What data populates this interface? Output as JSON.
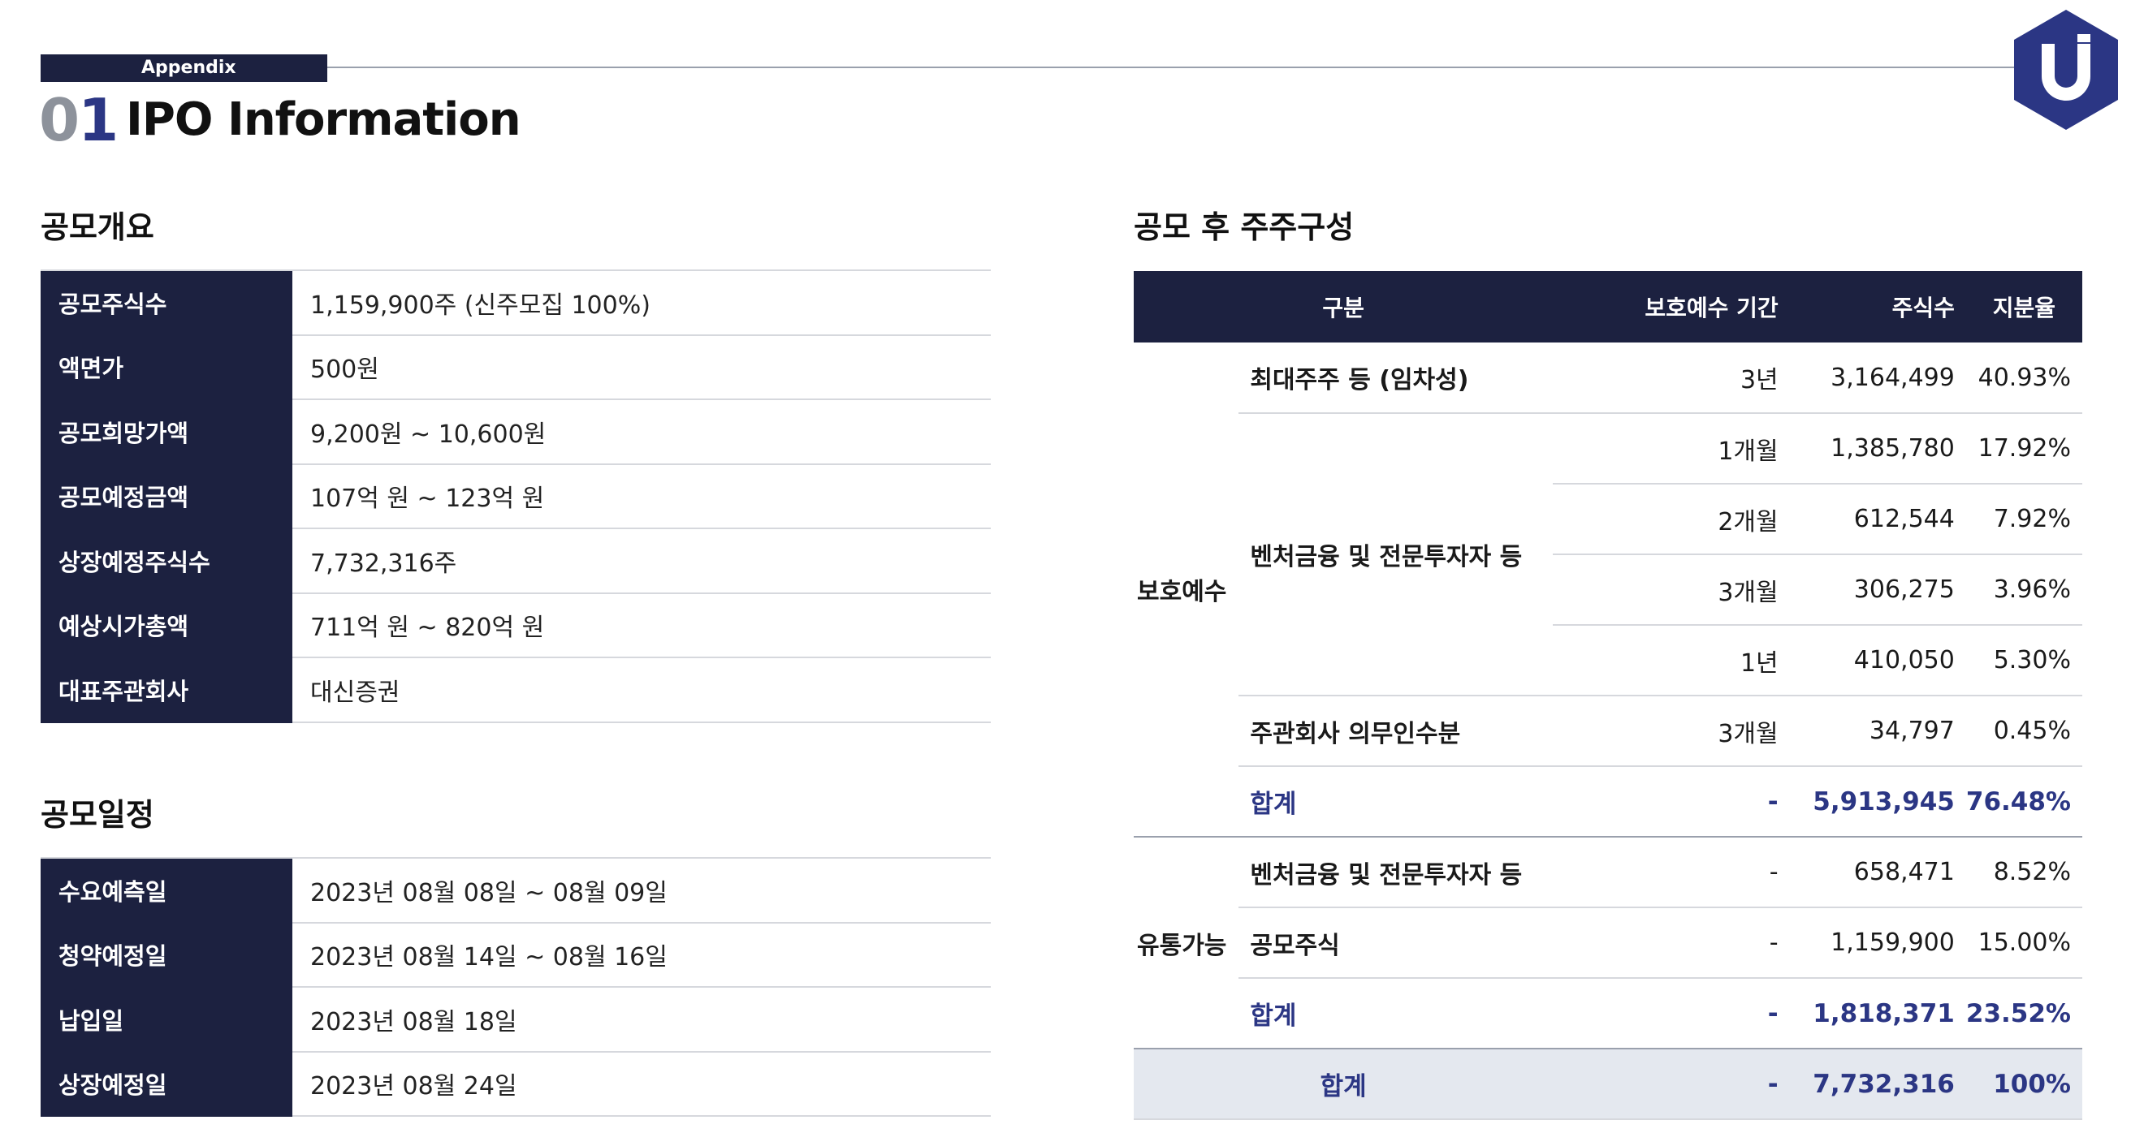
{
  "header": {
    "appendix_label": "Appendix",
    "page_number_prefix": "0",
    "page_number_suffix": "1",
    "title": "IPO Information"
  },
  "brand": {
    "logo_icon": "hexagon-u-logo-icon",
    "navy": "#1c2140",
    "accent_blue": "#2b3684",
    "gray_digit": "#8d929b"
  },
  "offering_overview": {
    "title": "공모개요",
    "rows": [
      {
        "label": "공모주식수",
        "value": "1,159,900주 (신주모집 100%)"
      },
      {
        "label": "액면가",
        "value": "500원"
      },
      {
        "label": "공모희망가액",
        "value": "9,200원 ~ 10,600원"
      },
      {
        "label": "공모예정금액",
        "value": "107억 원 ~ 123억 원"
      },
      {
        "label": "상장예정주식수",
        "value": "7,732,316주"
      },
      {
        "label": "예상시가총액",
        "value": "711억 원 ~ 820억 원"
      },
      {
        "label": "대표주관회사",
        "value": "대신증권"
      }
    ]
  },
  "offering_schedule": {
    "title": "공모일정",
    "rows": [
      {
        "label": "수요예측일",
        "value": "2023년 08월 08일 ~ 08월 09일"
      },
      {
        "label": "청약예정일",
        "value": "2023년 08월 14일 ~ 08월 16일"
      },
      {
        "label": "납입일",
        "value": "2023년 08월 18일"
      },
      {
        "label": "상장예정일",
        "value": "2023년 08월 24일"
      }
    ]
  },
  "shareholders": {
    "title": "공모 후 주주구성",
    "headers": {
      "category": "구분",
      "lockup": "보호예수 기간",
      "shares": "주식수",
      "ratio": "지분율"
    },
    "locked": {
      "group": "보호예수",
      "r1": {
        "category": "최대주주 등 (임차성)",
        "lockup": "3년",
        "shares": "3,164,499",
        "ratio": "40.93%"
      },
      "venture": {
        "category": "벤처금융 및 전문투자자 등",
        "rows": [
          {
            "lockup": "1개월",
            "shares": "1,385,780",
            "ratio": "17.92%"
          },
          {
            "lockup": "2개월",
            "shares": "612,544",
            "ratio": "7.92%"
          },
          {
            "lockup": "3개월",
            "shares": "306,275",
            "ratio": "3.96%"
          },
          {
            "lockup": "1년",
            "shares": "410,050",
            "ratio": "5.30%"
          }
        ]
      },
      "r6": {
        "category": "주관회사 의무인수분",
        "lockup": "3개월",
        "shares": "34,797",
        "ratio": "0.45%"
      },
      "subtotal": {
        "category": "합계",
        "lockup": "-",
        "shares": "5,913,945",
        "ratio": "76.48%"
      }
    },
    "tradable": {
      "group": "유통가능",
      "r1": {
        "category": "벤처금융 및 전문투자자 등",
        "lockup": "-",
        "shares": "658,471",
        "ratio": "8.52%"
      },
      "r2": {
        "category": "공모주식",
        "lockup": "-",
        "shares": "1,159,900",
        "ratio": "15.00%"
      },
      "subtotal": {
        "category": "합계",
        "lockup": "-",
        "shares": "1,818,371",
        "ratio": "23.52%"
      }
    },
    "total": {
      "category": "합계",
      "lockup": "-",
      "shares": "7,732,316",
      "ratio": "100%"
    }
  }
}
